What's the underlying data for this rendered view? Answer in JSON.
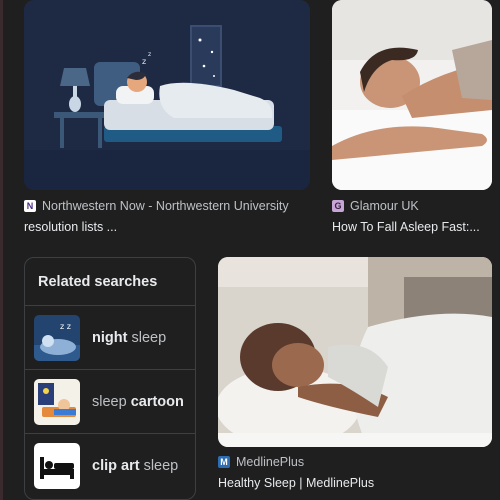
{
  "results": [
    {
      "source": "Northwestern Now - Northwestern University",
      "title": "resolution lists ...",
      "favicon_letter": "N",
      "favicon_color": "#4e2a84",
      "image_icon": "person-sleeping-in-bed-illustration"
    },
    {
      "source": "Glamour UK",
      "title": "How To Fall Asleep Fast:...",
      "favicon_letter": "G",
      "favicon_color": "#c7a6d6",
      "image_icon": "woman-sleeping-photo"
    },
    {
      "source": "MedlinePlus",
      "title": "Healthy Sleep | MedlinePlus",
      "favicon_letter": "M",
      "favicon_color": "#2f6db3",
      "image_icon": "woman-sleeping-pillow-photo"
    }
  ],
  "related": {
    "heading": "Related searches",
    "items": [
      {
        "bold": "night",
        "normal": " sleep",
        "bold_first": true,
        "icon": "night-sleep-thumb"
      },
      {
        "normal": "sleep ",
        "bold": "cartoon",
        "bold_first": false,
        "icon": "sleep-cartoon-thumb"
      },
      {
        "bold": "clip art",
        "normal": " sleep",
        "bold_first": true,
        "icon": "bed-clipart-thumb"
      }
    ]
  },
  "colors": {
    "background": "#1f1f1f",
    "text": "#e8eaed",
    "secondary": "#bdc1c6",
    "border": "#3c4043"
  }
}
